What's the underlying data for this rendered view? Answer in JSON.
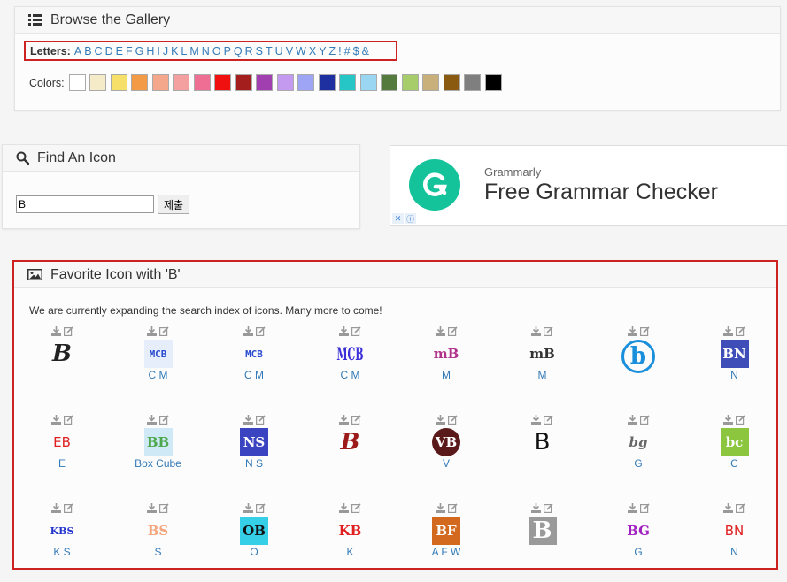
{
  "gallery": {
    "title": "Browse the Gallery",
    "letters_label": "Letters:",
    "letters": [
      "A",
      "B",
      "C",
      "D",
      "E",
      "F",
      "G",
      "H",
      "I",
      "J",
      "K",
      "L",
      "M",
      "N",
      "O",
      "P",
      "Q",
      "R",
      "S",
      "T",
      "U",
      "V",
      "W",
      "X",
      "Y",
      "Z",
      "!",
      "#",
      "$",
      "&"
    ],
    "colors_label": "Colors:",
    "colors": [
      "#ffffff",
      "#f5ebc8",
      "#f7e06a",
      "#f29a45",
      "#f5a78c",
      "#f4a0a0",
      "#ee6f93",
      "#f01010",
      "#a51e1e",
      "#a23fb0",
      "#c39af0",
      "#9fa5f5",
      "#1e2fa0",
      "#26c6c6",
      "#9ad5f2",
      "#547a3d",
      "#a7cc6a",
      "#c9b07a",
      "#8a5a10",
      "#7f7f7f",
      "#000000"
    ]
  },
  "find": {
    "title": "Find An Icon",
    "input_value": "B",
    "submit_label": "제출"
  },
  "ad": {
    "brand": "Grammarly",
    "headline": "Free Grammar Checker"
  },
  "favorites": {
    "title": "Favorite Icon with 'B'",
    "notice": "We are currently expanding the search index of icons. Many more to come!",
    "icons": [
      {
        "caption": "",
        "glyph": "B",
        "color": "#222222",
        "bg": "transparent",
        "style": "italic"
      },
      {
        "caption": "C M",
        "glyph": "MCB",
        "color": "#2a4bd0",
        "bg": "#e6eefc",
        "style": "stair"
      },
      {
        "caption": "C M",
        "glyph": "MCB",
        "color": "#2a4bd0",
        "bg": "transparent",
        "style": "stair"
      },
      {
        "caption": "C M",
        "glyph": "MCB",
        "color": "#3b2fd8",
        "bg": "transparent",
        "style": "tall"
      },
      {
        "caption": "M",
        "glyph": "mB",
        "color": "#b0308a",
        "bg": "transparent",
        "style": "normal"
      },
      {
        "caption": "M",
        "glyph": "mB",
        "color": "#333333",
        "bg": "transparent",
        "style": "normal"
      },
      {
        "caption": "",
        "glyph": "b",
        "color": "#1a8fdc",
        "bg": "transparent",
        "style": "circle"
      },
      {
        "caption": "N",
        "glyph": "BN",
        "color": "#ffffff",
        "bg": "#3e4db8",
        "style": "box"
      },
      {
        "caption": "E",
        "glyph": "EB",
        "color": "#e02020",
        "bg": "transparent",
        "style": "outline"
      },
      {
        "caption": "Box Cube",
        "glyph": "BB",
        "color": "#4da84d",
        "bg": "#cfe9f7",
        "style": "box"
      },
      {
        "caption": "N S",
        "glyph": "NS",
        "color": "#ffffff",
        "bg": "#3a44c0",
        "style": "box"
      },
      {
        "caption": "",
        "glyph": "B",
        "color": "#9c1a1a",
        "bg": "transparent",
        "style": "italic"
      },
      {
        "caption": "V",
        "glyph": "VB",
        "color": "#ffffff",
        "bg": "#5a1a1a",
        "style": "circle"
      },
      {
        "caption": "",
        "glyph": "B",
        "color": "#111111",
        "bg": "transparent",
        "style": "outline"
      },
      {
        "caption": "G",
        "glyph": "bg",
        "color": "#666666",
        "bg": "transparent",
        "style": "italic"
      },
      {
        "caption": "C",
        "glyph": "bc",
        "color": "#ffffff",
        "bg": "#8cc63e",
        "style": "box"
      },
      {
        "caption": "K S",
        "glyph": "KBS",
        "color": "#2233cc",
        "bg": "transparent",
        "style": "normal"
      },
      {
        "caption": "S",
        "glyph": "BS",
        "color": "#f4a57a",
        "bg": "transparent",
        "style": "normal"
      },
      {
        "caption": "O",
        "glyph": "OB",
        "color": "#111111",
        "bg": "#35d0e8",
        "style": "box"
      },
      {
        "caption": "K",
        "glyph": "KB",
        "color": "#e02020",
        "bg": "transparent",
        "style": "normal"
      },
      {
        "caption": "A F W",
        "glyph": "BF",
        "color": "#ffffff",
        "bg": "#d2691e",
        "style": "box"
      },
      {
        "caption": "",
        "glyph": "B",
        "color": "#ffffff",
        "bg": "#9a9a9a",
        "style": "box"
      },
      {
        "caption": "G",
        "glyph": "BG",
        "color": "#a020c0",
        "bg": "transparent",
        "style": "normal"
      },
      {
        "caption": "N",
        "glyph": "BN",
        "color": "#e02020",
        "bg": "transparent",
        "style": "outline"
      }
    ]
  }
}
